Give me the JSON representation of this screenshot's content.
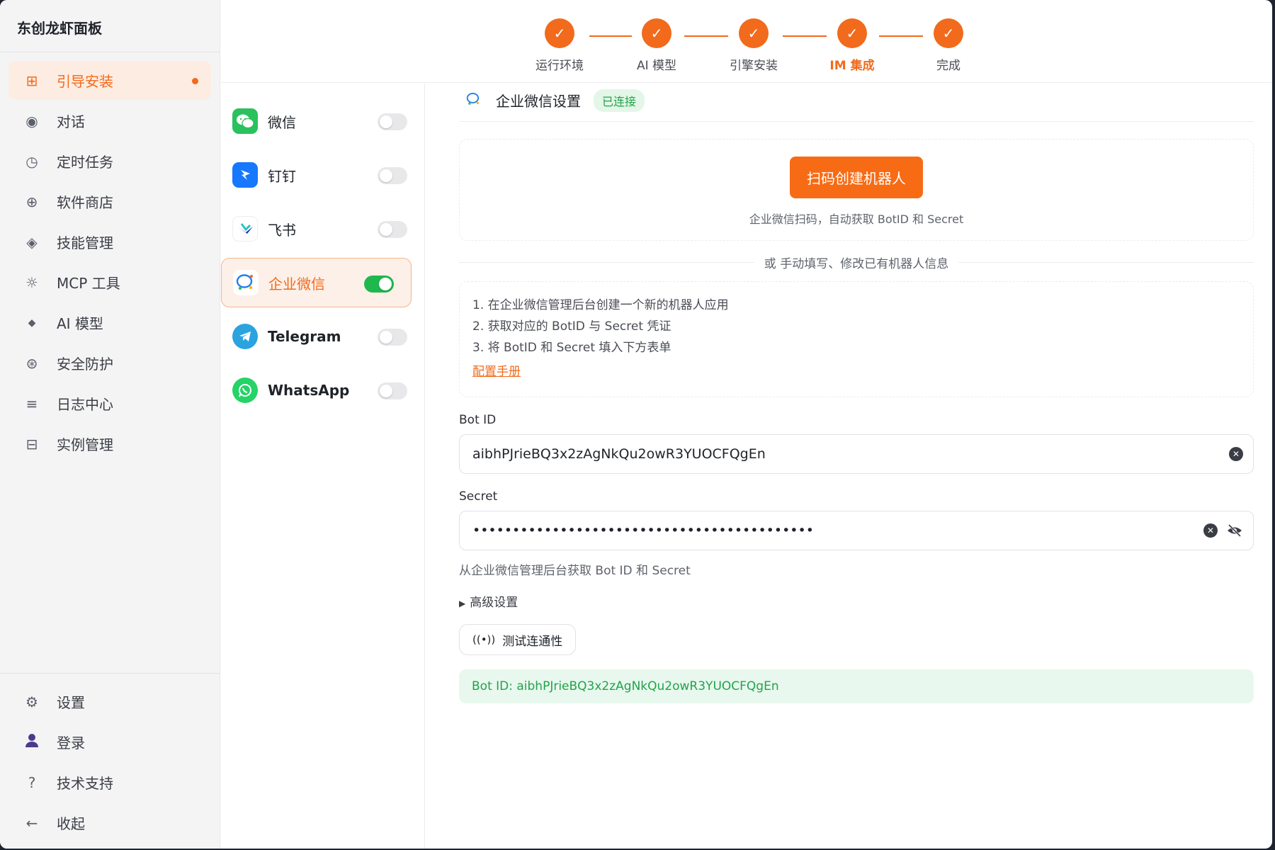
{
  "app": {
    "title": "东创龙虾面板"
  },
  "sidebar": {
    "items": [
      {
        "label": "引导安装",
        "icon": "grid-icon",
        "active": true
      },
      {
        "label": "对话",
        "icon": "chat-icon"
      },
      {
        "label": "定时任务",
        "icon": "clock-icon"
      },
      {
        "label": "软件商店",
        "icon": "store-icon"
      },
      {
        "label": "技能管理",
        "icon": "diamond-icon"
      },
      {
        "label": "MCP 工具",
        "icon": "gear-icon"
      },
      {
        "label": "AI 模型",
        "icon": "sparkle-icon"
      },
      {
        "label": "安全防护",
        "icon": "shield-icon"
      },
      {
        "label": "日志中心",
        "icon": "list-icon"
      },
      {
        "label": "实例管理",
        "icon": "instance-icon"
      }
    ],
    "bottom": [
      {
        "label": "设置",
        "icon": "settings-icon"
      },
      {
        "label": "登录",
        "icon": "user-icon"
      },
      {
        "label": "技术支持",
        "icon": "help-icon"
      },
      {
        "label": "收起",
        "icon": "collapse-icon"
      }
    ]
  },
  "stepper": {
    "steps": [
      {
        "label": "运行环境",
        "done": true
      },
      {
        "label": "AI 模型",
        "done": true
      },
      {
        "label": "引擎安装",
        "done": true
      },
      {
        "label": "IM 集成",
        "done": true,
        "current": true
      },
      {
        "label": "完成",
        "done": true
      }
    ]
  },
  "channels": [
    {
      "name": "微信",
      "icon": "wechat-icon",
      "enabled": false
    },
    {
      "name": "钉钉",
      "icon": "dingtalk-icon",
      "enabled": false
    },
    {
      "name": "飞书",
      "icon": "feishu-icon",
      "enabled": false
    },
    {
      "name": "企业微信",
      "icon": "wecom-icon",
      "enabled": true,
      "active": true
    },
    {
      "name": "Telegram",
      "icon": "telegram-icon",
      "enabled": false
    },
    {
      "name": "WhatsApp",
      "icon": "whatsapp-icon",
      "enabled": false
    }
  ],
  "panel": {
    "title": "企业微信设置",
    "status": "已连接",
    "scan_button": "扫码创建机器人",
    "scan_hint": "企业微信扫码，自动获取 BotID 和 Secret",
    "divider": "或 手动填写、修改已有机器人信息",
    "instructions": [
      "1. 在企业微信管理后台创建一个新的机器人应用",
      "2. 获取对应的 BotID 与 Secret 凭证",
      "3. 将 BotID 和 Secret 填入下方表单"
    ],
    "manual_link": "配置手册",
    "botid_label": "Bot ID",
    "botid_value": "aibhPJrieBQ3x2zAgNkQu2owR3YUOCFQgEn",
    "secret_label": "Secret",
    "secret_value": "•••••••••••••••••••••••••••••••••••••••••••",
    "help_text": "从企业微信管理后台获取 Bot ID 和 Secret",
    "advanced_label": "高级设置",
    "test_button": "测试连通性",
    "result_text": "Bot ID: aibhPJrieBQ3x2zAgNkQu2owR3YUOCFQgEn"
  },
  "colors": {
    "accent": "#f26a1b",
    "success": "#22a34a",
    "toggle_on": "#1fb84f"
  }
}
